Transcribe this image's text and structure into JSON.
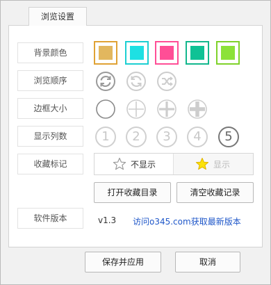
{
  "tab": {
    "label": "浏览设置"
  },
  "labels": {
    "bg_color": "背景颜色",
    "browse_order": "浏览顺序",
    "border_size": "边框大小",
    "columns": "显示列数",
    "fav_mark": "收藏标记",
    "version": "软件版本"
  },
  "colors": [
    {
      "name": "gold",
      "fill": "#e2b75e",
      "border": "#e0a234"
    },
    {
      "name": "cyan",
      "fill": "#1ee0e3",
      "border": "#1ccfd2"
    },
    {
      "name": "pink",
      "fill": "#ff4e96",
      "border": "#ff4e96"
    },
    {
      "name": "teal",
      "fill": "#0fc295",
      "border": "#12b78d"
    },
    {
      "name": "lime",
      "fill": "#8ce238",
      "border": "#7fd22a"
    }
  ],
  "browse_order_icons": [
    "sequential-refresh-icon",
    "reverse-refresh-icon",
    "shuffle-icon"
  ],
  "border_icons": [
    "circle-empty-icon",
    "thin-cross-icon",
    "medium-cross-icon",
    "thick-cross-icon"
  ],
  "column_options": [
    "1",
    "2",
    "3",
    "4",
    "5"
  ],
  "selected_columns": "5",
  "fav": {
    "hide_label": "不显示",
    "show_label": "显示"
  },
  "buttons": {
    "open_fav_dir": "打开收藏目录",
    "clear_fav": "清空收藏记录",
    "save_apply": "保存并应用",
    "cancel": "取消"
  },
  "version": {
    "value": "v1.3",
    "link": "访问o345.com获取最新版本"
  }
}
